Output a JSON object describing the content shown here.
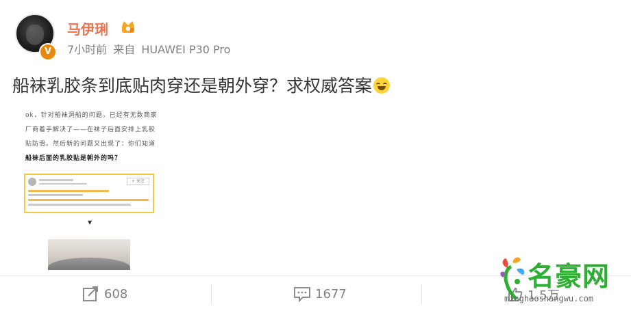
{
  "post": {
    "username": "马伊琍",
    "time": "7小时前",
    "source_prefix": "来自",
    "device": "HUAWEI P30 Pro",
    "verified_badge": "V",
    "text": "船袜乳胶条到底贴肉穿还是朝外穿？求权威答案",
    "emoji": "laugh-cry-emoji",
    "image": {
      "caption_lines": [
        "ok，针对船袜洞船的问题，已经有无数商家",
        "厂商着手解决了——在袜子后面安排上乳胶",
        "贴防滑。然后新的问题又出现了：你们知道"
      ],
      "caption_bold": "船袜后面的乳胶贴是朝外的吗？",
      "comment_button": "+ 关注",
      "arrow": "▼"
    }
  },
  "actions": {
    "forward_count": "608",
    "comment_count": "1677",
    "like_count": "1.5万"
  },
  "watermark": {
    "title": "名豪网",
    "url": "minghaoshangwu.com"
  },
  "colors": {
    "username": "#eb7350",
    "badge": "#e8890c",
    "watermark_green": "#2fae34",
    "highlight_border": "#f2c744"
  }
}
